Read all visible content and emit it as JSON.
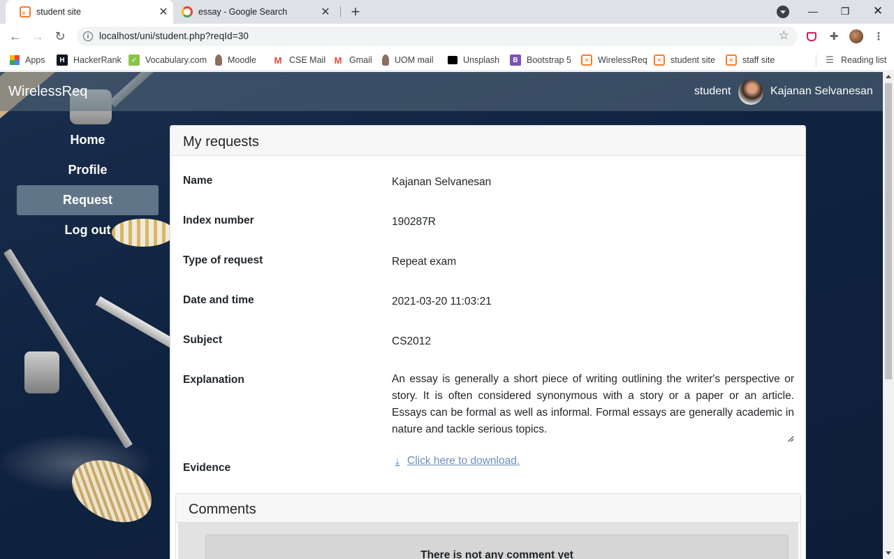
{
  "browser": {
    "tabs": [
      {
        "label": "student site",
        "icon": "xampp-icon",
        "active": true
      },
      {
        "label": "essay - Google Search",
        "icon": "google-icon",
        "active": false
      }
    ],
    "url": "localhost/uni/student.php?reqId=30",
    "bookmarks": [
      {
        "label": "Apps",
        "icon": "apps-grid-icon"
      },
      {
        "label": "HackerRank",
        "icon": "hackerrank-icon"
      },
      {
        "label": "Vocabulary.com",
        "icon": "vocabulary-icon"
      },
      {
        "label": "Moodle",
        "icon": "moodle-icon"
      },
      {
        "label": "CSE Mail",
        "icon": "gmail-icon"
      },
      {
        "label": "Gmail",
        "icon": "gmail-icon"
      },
      {
        "label": "UOM mail",
        "icon": "moodle-icon"
      },
      {
        "label": "Unsplash",
        "icon": "unsplash-icon"
      },
      {
        "label": "Bootstrap 5",
        "icon": "bootstrap-icon"
      },
      {
        "label": "WirelessReq",
        "icon": "xampp-icon"
      },
      {
        "label": "student site",
        "icon": "xampp-icon"
      },
      {
        "label": "staff site",
        "icon": "xampp-icon"
      }
    ],
    "reading_list": "Reading list"
  },
  "app": {
    "brand": "WirelessReq",
    "user_role": "student",
    "user_name": "Kajanan Selvanesan"
  },
  "sidebar": {
    "items": [
      {
        "label": "Home",
        "active": false
      },
      {
        "label": "Profile",
        "active": false
      },
      {
        "label": "Request",
        "active": true
      },
      {
        "label": "Log out",
        "active": false
      }
    ]
  },
  "request": {
    "title": "My requests",
    "fields": [
      {
        "label": "Name",
        "value": "Kajanan Selvanesan"
      },
      {
        "label": "Index number",
        "value": "190287R"
      },
      {
        "label": "Type of request",
        "value": "Repeat exam"
      },
      {
        "label": "Date and time",
        "value": "2021-03-20 11:03:21"
      },
      {
        "label": "Subject",
        "value": "CS2012"
      }
    ],
    "explanation_label": "Explanation",
    "explanation": "An essay is generally a short piece of writing outlining the writer's perspective or story. It is often considered synonymous with a story or a paper or an article. Essays can be formal as well as informal. Formal essays are generally academic in nature and tackle serious topics.",
    "evidence_label": "Evidence",
    "evidence_link": "Click here to download."
  },
  "comments": {
    "title": "Comments",
    "empty_message": "There is not any comment yet"
  },
  "colors": {
    "link": "#6c8ebf",
    "xampp_orange": "#fb7a24",
    "nav_overlay": "#5a6e7d"
  }
}
